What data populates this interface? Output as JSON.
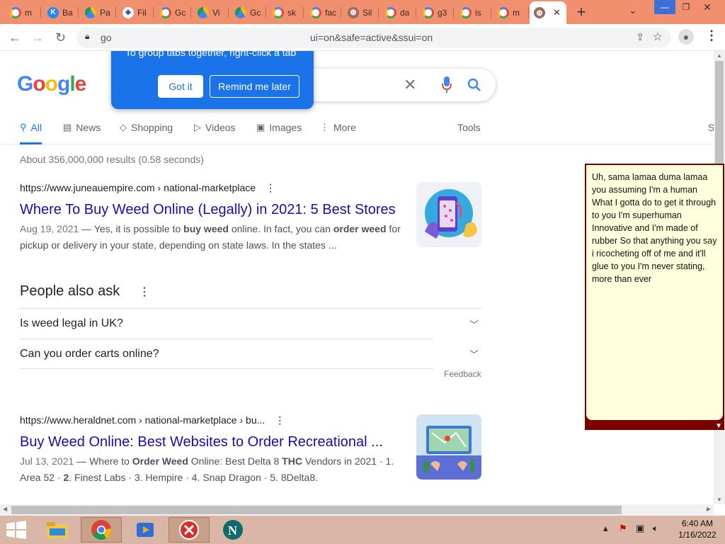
{
  "browser": {
    "tabs": [
      {
        "label": "m",
        "icon": "google-icon"
      },
      {
        "label": "Ba",
        "icon": "vk-icon"
      },
      {
        "label": "Pa",
        "icon": "drive-icon"
      },
      {
        "label": "Fil",
        "icon": "s-icon"
      },
      {
        "label": "Gc",
        "icon": "google-icon"
      },
      {
        "label": "Vi",
        "icon": "drive-icon"
      },
      {
        "label": "Gc",
        "icon": "drive-icon"
      },
      {
        "label": "sk",
        "icon": "google-icon"
      },
      {
        "label": "fac",
        "icon": "google-icon"
      },
      {
        "label": "Sil",
        "icon": "web-icon"
      },
      {
        "label": "da",
        "icon": "google-icon"
      },
      {
        "label": "g3",
        "icon": "google-icon"
      },
      {
        "label": "is",
        "icon": "google-icon"
      },
      {
        "label": "m",
        "icon": "google-icon"
      }
    ],
    "url_start": "go",
    "url_end": "ui=on&safe=active&ssui=on"
  },
  "popup": {
    "text": "To group tabs together, right-click a tab",
    "got_it": "Got it",
    "remind": "Remind me later"
  },
  "search": {
    "logo": [
      "G",
      "o",
      "o",
      "g",
      "l",
      "e"
    ],
    "tabs": [
      {
        "label": "All",
        "icon": "⚲"
      },
      {
        "label": "News",
        "icon": "▤"
      },
      {
        "label": "Shopping",
        "icon": "◇"
      },
      {
        "label": "Videos",
        "icon": "▷"
      },
      {
        "label": "Images",
        "icon": "▣"
      },
      {
        "label": "More",
        "icon": "⋮"
      }
    ],
    "tools": "Tools",
    "safe_cut": "S",
    "results_count": "About 356,000,000 results (0.58 seconds)"
  },
  "results": [
    {
      "cite": "https://www.juneauempire.com › national-marketplace",
      "title": "Where To Buy Weed Online (Legally) in 2021: 5 Best Stores",
      "date": "Aug 19, 2021",
      "snippet": " — Yes, it is possible to buy weed online. In fact, you can order weed for pickup or delivery in your state, depending on state laws. In the states ..."
    },
    {
      "cite": "https://www.heraldnet.com › national-marketplace › bu...",
      "title": "Buy Weed Online: Best Websites to Order Recreational ...",
      "date": "Jul 13, 2021",
      "snippet": " — Where to Order Weed Online: Best Delta 8 THC Vendors in 2021 · 1. Area 52 · 2. Finest Labs · 3. Hempire · 4. Snap Dragon · 5. 8Delta8."
    }
  ],
  "paa": {
    "title": "People also ask",
    "questions": [
      "Is weed legal in UK?",
      "Can you order carts online?"
    ],
    "feedback": "Feedback"
  },
  "note": {
    "text": "Uh, sama lamaa duma lamaa you assuming I'm a human What I gotta do to get it through to you I'm superhuman Innovative and I'm made of rubber So that anything you say i ricocheting off of me and it'll glue to you I'm never stating, more than ever"
  },
  "taskbar": {
    "time": "6:40 AM",
    "date": "1/16/2022"
  },
  "colors": {
    "tabbar": "#f0906f",
    "link": "#1a0dab",
    "accent": "#1a73e8",
    "note_bg": "#ffffdd",
    "note_border": "#7a0000"
  }
}
